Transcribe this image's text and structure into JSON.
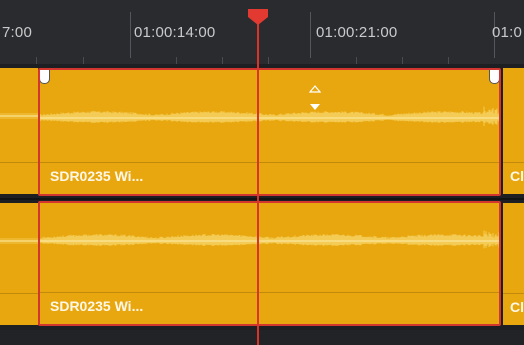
{
  "ruler": {
    "timecodes": [
      "7:00",
      "01:00:14:00",
      "01:00:21:00",
      "01:0"
    ]
  },
  "tracks": [
    {
      "clip_name": "SDR0235 Wi...",
      "next_clip_label": "Cl"
    },
    {
      "clip_name": "SDR0235 Wi...",
      "next_clip_label": "Cl"
    }
  ],
  "colors": {
    "clip": "#e8a70f",
    "selection": "#d2362e",
    "playhead": "#d9342c",
    "background": "#26272b"
  },
  "icons": {
    "playhead": "playhead-marker-icon",
    "fade_in": "fade-up-arrow-icon",
    "fade_out": "fade-down-arrow-icon",
    "trim": "trim-handle-icon"
  }
}
